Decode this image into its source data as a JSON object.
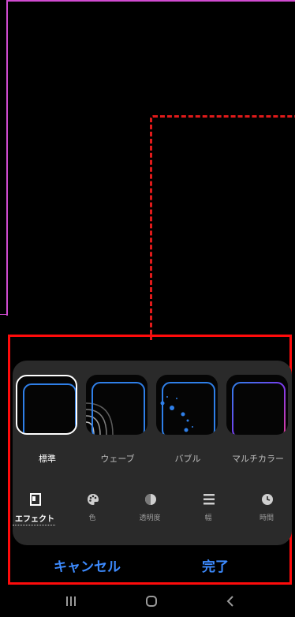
{
  "effects": [
    {
      "label": "標準",
      "selected": true,
      "icon": "standard-effect-thumbnail"
    },
    {
      "label": "ウェーブ",
      "selected": false,
      "icon": "wave-effect-thumbnail"
    },
    {
      "label": "バブル",
      "selected": false,
      "icon": "bubble-effect-thumbnail"
    },
    {
      "label": "マルチカラー",
      "selected": false,
      "icon": "multicolor-effect-thumbnail"
    }
  ],
  "tabs": [
    {
      "label": "エフェクト",
      "icon": "effect-icon",
      "active": true
    },
    {
      "label": "色",
      "icon": "palette-icon",
      "active": false
    },
    {
      "label": "透明度",
      "icon": "transparency-icon",
      "active": false
    },
    {
      "label": "幅",
      "icon": "width-icon",
      "active": false
    },
    {
      "label": "時間",
      "icon": "clock-icon",
      "active": false
    }
  ],
  "actions": {
    "cancel_label": "キャンセル",
    "done_label": "完了"
  },
  "navbar": {
    "icons": [
      "recent-apps-icon",
      "home-icon",
      "back-icon"
    ]
  },
  "colors": {
    "accent": "#3d8bff",
    "highlight": "#ff0b0b",
    "frame": "#d04bd0",
    "panel": "#2a2a2a"
  }
}
